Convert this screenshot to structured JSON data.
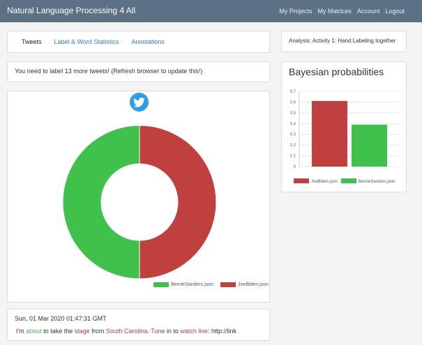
{
  "app": {
    "title": "Natural Language Processing 4 All"
  },
  "nav": [
    {
      "label": "My Projects"
    },
    {
      "label": "My Matrices"
    },
    {
      "label": "Account"
    },
    {
      "label": "Logout"
    }
  ],
  "tabs": [
    {
      "label": "Tweets",
      "active": true
    },
    {
      "label": "Label & Word Statistics"
    },
    {
      "label": "Annotations"
    }
  ],
  "notice": "You need to label 13 more tweets! (Refresh browser to update this!)",
  "analysis": "Analysis: Activity 1: Hand Labeling together",
  "bayes_title": "Bayesian probabilities",
  "twitter_icon": "twitter-bird-icon",
  "tweet": {
    "date": "Sun, 01 Mar 2020 01:47:31 GMT",
    "parts": [
      {
        "text": "I'm "
      },
      {
        "text": "about",
        "color": "green"
      },
      {
        "text": " to take the "
      },
      {
        "text": "stage",
        "color": "red"
      },
      {
        "text": " from "
      },
      {
        "text": "South Carolina",
        "color": "red"
      },
      {
        "text": ". "
      },
      {
        "text": "Tune",
        "color": "red"
      },
      {
        "text": " in to "
      },
      {
        "text": "watch live",
        "color": "red"
      },
      {
        "text": ": http://link"
      }
    ]
  },
  "colors": {
    "green": "#3fc14b",
    "red": "#c04040",
    "navbar": "#5c7185",
    "link": "#2d7ec8"
  },
  "chart_data": [
    {
      "type": "pie",
      "variant": "doughnut",
      "labels": [
        "BernieSanders.json",
        "JoeBiden.json"
      ],
      "values": [
        50,
        50
      ],
      "colors": [
        "#3fc14b",
        "#c04040"
      ],
      "legend": "bottom"
    },
    {
      "type": "bar",
      "categories": [
        "JoeBiden.json",
        "BernieSanders.json"
      ],
      "values": [
        0.61,
        0.39
      ],
      "colors": [
        "#c04040",
        "#3fc14b"
      ],
      "yticks": [
        "0.7",
        "0.6",
        "0.5",
        "0.4",
        "0.3",
        "0.2",
        "0.1",
        "0"
      ],
      "ylim": [
        0,
        0.7
      ],
      "grid": true,
      "legend": "bottom"
    }
  ]
}
